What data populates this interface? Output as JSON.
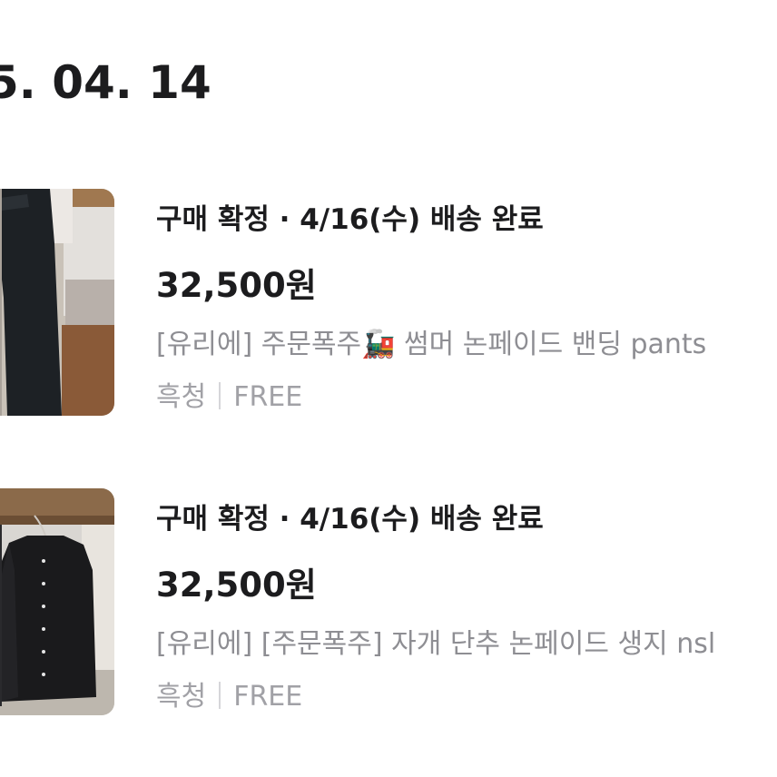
{
  "order": {
    "date": "5. 04. 14"
  },
  "items": [
    {
      "status": "구매 확정 · 4/16(수) 배송 완료",
      "price": "32,500원",
      "title_prefix": "[유리에] 주문폭주",
      "title_emoji": "🚂",
      "title_suffix": " 썸머 논페이드 밴딩 pants",
      "color_option": "흑청",
      "size_option": "FREE",
      "thumbnail_icon": "black-pants-photo"
    },
    {
      "status": "구매 확정 · 4/16(수) 배송 완료",
      "price": "32,500원",
      "title_prefix": "[유리에] [주문폭주] 자개 단추 논페이드 생지 nsl",
      "title_emoji": "",
      "title_suffix": "",
      "color_option": "흑청",
      "size_option": "FREE",
      "thumbnail_icon": "black-blouse-photo"
    }
  ]
}
